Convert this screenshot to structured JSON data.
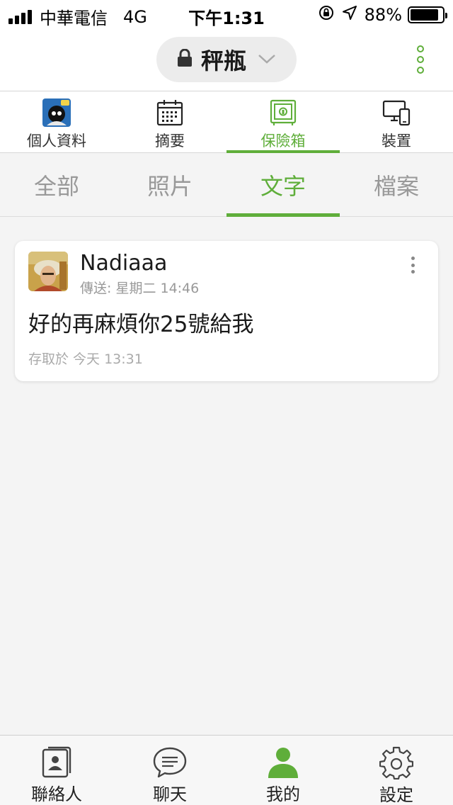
{
  "status_bar": {
    "carrier": "中華電信",
    "network": "4G",
    "time": "下午1:31",
    "battery_text": "88%",
    "battery_level": 0.88
  },
  "header": {
    "title": "秤瓶",
    "lock_icon": "lock-icon",
    "dropdown_icon": "chevron-down-icon",
    "menu_icon": "more-vertical-icon",
    "accent_color": "#5fae3a"
  },
  "top_tabs": [
    {
      "label": "個人資料",
      "icon": "profile-avatar-icon",
      "active": false
    },
    {
      "label": "摘要",
      "icon": "calendar-icon",
      "active": false
    },
    {
      "label": "保險箱",
      "icon": "safe-icon",
      "active": true
    },
    {
      "label": "裝置",
      "icon": "devices-icon",
      "active": false
    }
  ],
  "sub_tabs": [
    {
      "label": "全部",
      "active": false
    },
    {
      "label": "照片",
      "active": false
    },
    {
      "label": "文字",
      "active": true
    },
    {
      "label": "檔案",
      "active": false
    }
  ],
  "card": {
    "sender": "Nadiaaa",
    "sent": "傳送: 星期二 14:46",
    "message": "好的再麻煩你25號給我",
    "saved": "存取於 今天 13:31"
  },
  "bottom_nav": [
    {
      "label": "聯絡人",
      "icon": "contacts-icon",
      "active": false
    },
    {
      "label": "聊天",
      "icon": "chat-icon",
      "active": false
    },
    {
      "label": "我的",
      "icon": "person-icon",
      "active": true
    },
    {
      "label": "設定",
      "icon": "settings-gear-icon",
      "active": false
    }
  ]
}
